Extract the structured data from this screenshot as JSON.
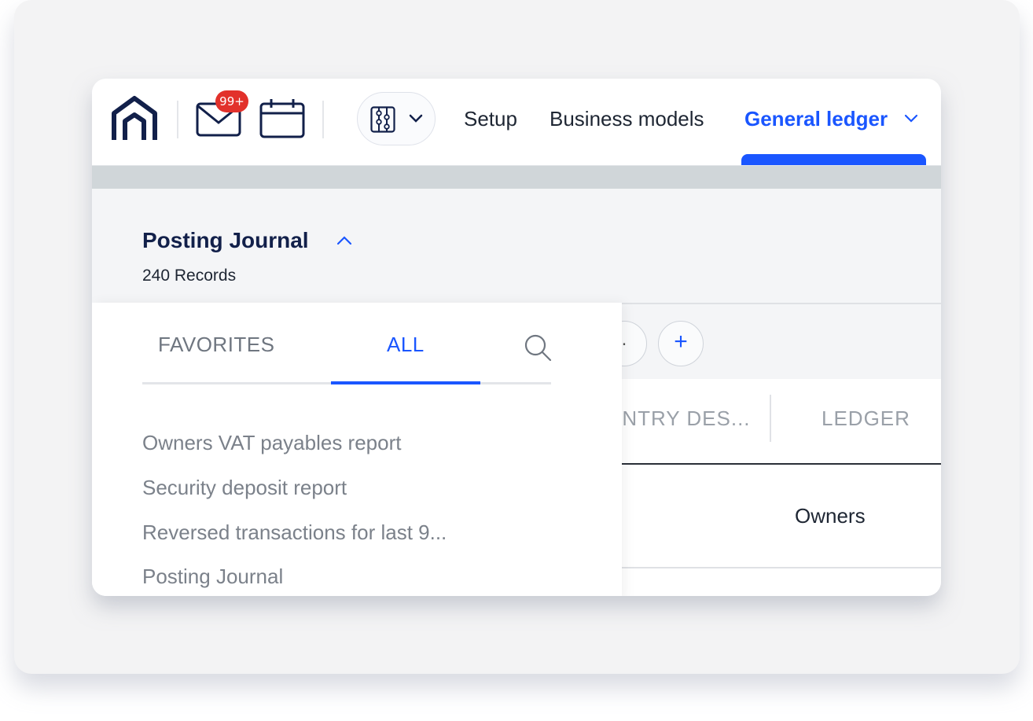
{
  "header": {
    "notification_badge": "99+",
    "nav": [
      {
        "label": "Setup"
      },
      {
        "label": "Business models"
      },
      {
        "label": "General ledger"
      }
    ]
  },
  "page": {
    "title": "Posting Journal",
    "records": "240 Records"
  },
  "toolbar": {
    "more_label": ".",
    "add_label": "+"
  },
  "table": {
    "columns": [
      "ENTRY DES...",
      "LEDGER"
    ],
    "rows": [
      {
        "ledger": "Owners"
      }
    ]
  },
  "dropdown": {
    "tabs": [
      {
        "label": "FAVORITES"
      },
      {
        "label": "ALL"
      }
    ],
    "active_tab": "ALL",
    "items": [
      {
        "label": "Owners VAT payables report"
      },
      {
        "label": "Security deposit report"
      },
      {
        "label": "Reversed transactions for last 9..."
      },
      {
        "label": "Posting Journal"
      }
    ]
  },
  "colors": {
    "accent": "#1a56ff",
    "badge": "#e2312b",
    "title": "#12204a"
  },
  "icons": {
    "logo": "home-logo-icon",
    "mail": "mail-icon",
    "calendar": "calendar-icon",
    "app_switcher": "abacus-icon",
    "search": "search-icon"
  }
}
